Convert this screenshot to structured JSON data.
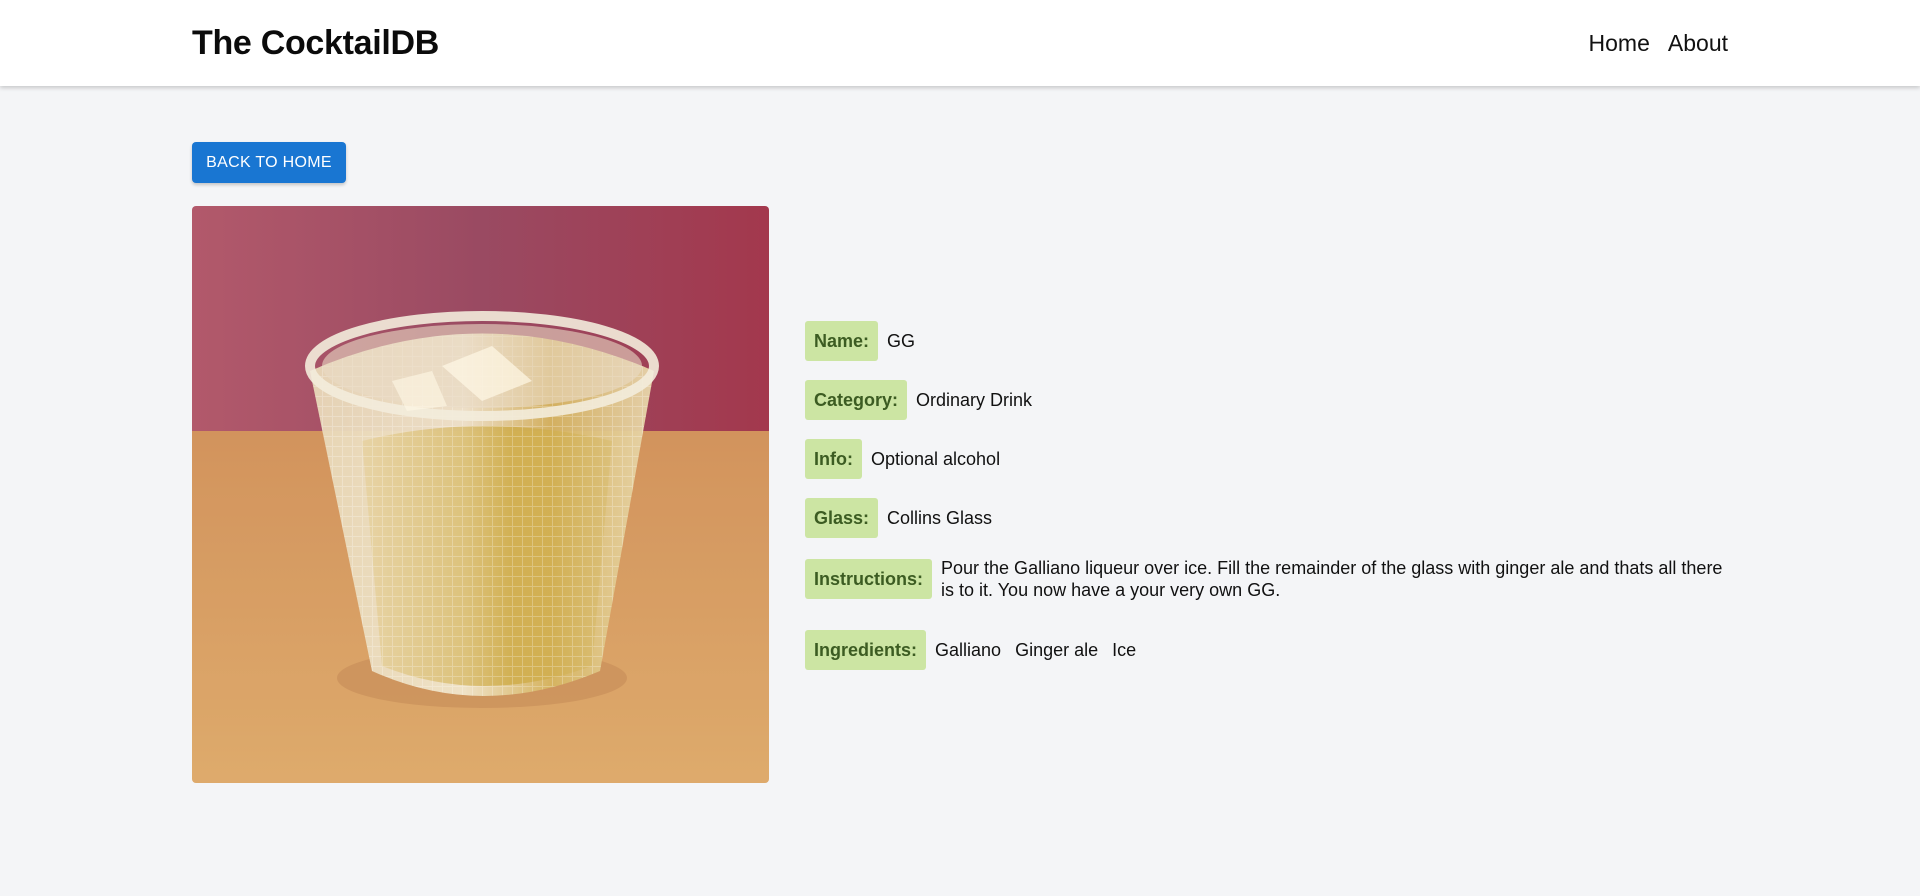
{
  "navbar": {
    "brand": "The CocktailDB",
    "links": [
      "Home",
      "About"
    ]
  },
  "back_button": "BACK TO HOME",
  "drink_image": {
    "alt": "GG"
  },
  "fields": {
    "name": {
      "label": "Name:",
      "value": "GG"
    },
    "category": {
      "label": "Category:",
      "value": "Ordinary Drink"
    },
    "info": {
      "label": "Info:",
      "value": "Optional alcohol"
    },
    "glass": {
      "label": "Glass:",
      "value": "Collins Glass"
    },
    "instructions": {
      "label": "Instructions:",
      "value": "Pour the Galliano liqueur over ice. Fill the remainder of the glass with ginger ale and thats all there is to it. You now have a your very own GG."
    },
    "ingredients": {
      "label": "Ingredients:",
      "values": [
        "Galliano",
        "Ginger ale",
        "Ice"
      ]
    }
  },
  "colors": {
    "accent": "#1976d2",
    "label_bg": "#cce5a3",
    "label_text": "#3c5c22",
    "page_bg": "#f4f5f7"
  }
}
